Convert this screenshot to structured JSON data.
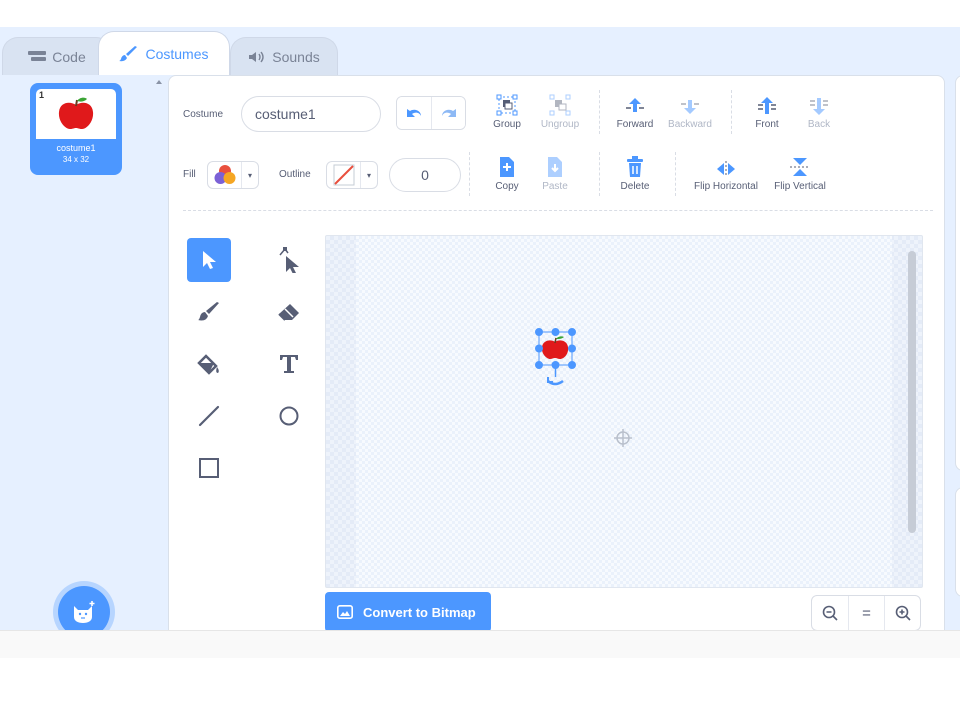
{
  "tabs": {
    "code": "Code",
    "costumes": "Costumes",
    "sounds": "Sounds"
  },
  "costume_list": [
    {
      "number": "1",
      "name": "costume1",
      "size": "34 x 32"
    }
  ],
  "toolbar": {
    "costume_label": "Costume",
    "costume_name": "costume1",
    "group": "Group",
    "ungroup": "Ungroup",
    "forward": "Forward",
    "backward": "Backward",
    "front": "Front",
    "back": "Back",
    "fill_label": "Fill",
    "outline_label": "Outline",
    "outline_width": "0",
    "copy": "Copy",
    "paste": "Paste",
    "delete": "Delete",
    "flip_horizontal": "Flip Horizontal",
    "flip_vertical": "Flip Vertical"
  },
  "tools": [
    "select",
    "reshape",
    "brush",
    "eraser",
    "fill",
    "text",
    "line",
    "circle",
    "rectangle"
  ],
  "convert_button": "Convert to Bitmap",
  "zoom": {
    "zoom_out": "zoom-out-icon",
    "reset": "=",
    "zoom_in": "zoom-in-icon"
  },
  "colors": {
    "accent": "#4c97ff",
    "apple": "#e0191b",
    "background": "#e6f0ff"
  }
}
